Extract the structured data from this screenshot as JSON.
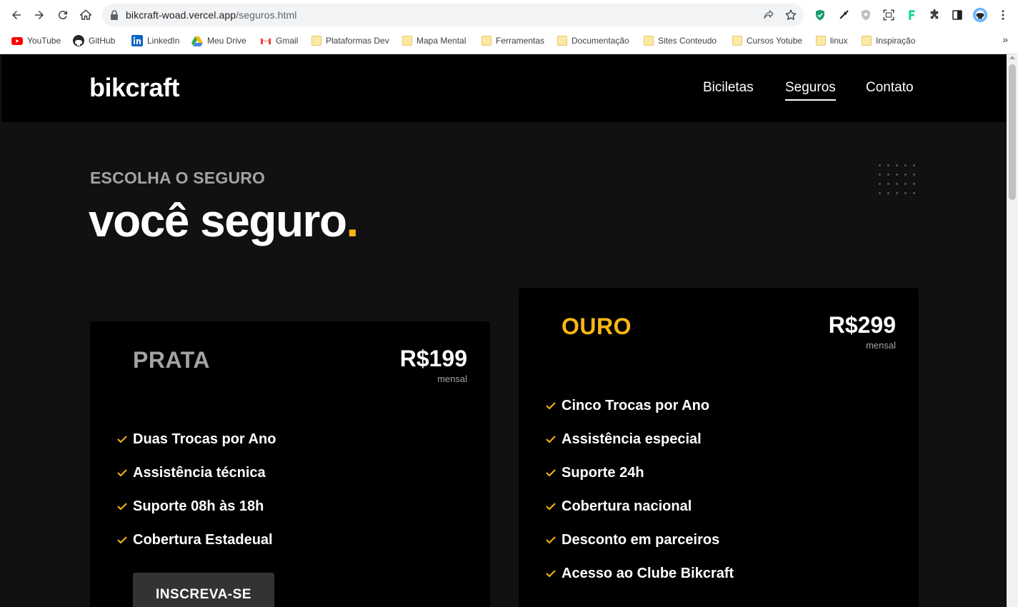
{
  "browser": {
    "url_host": "bikcraft-woad.vercel.app",
    "url_path": "/seguros.html",
    "bookmarks": [
      {
        "label": "YouTube",
        "icon": "youtube-icon"
      },
      {
        "label": "GitHub",
        "icon": "github-icon"
      },
      {
        "label": "LinkedIn",
        "icon": "linkedin-icon"
      },
      {
        "label": "Meu Drive",
        "icon": "drive-icon"
      },
      {
        "label": "Gmail",
        "icon": "gmail-icon"
      },
      {
        "label": "Plataformas Dev",
        "icon": "folder-icon"
      },
      {
        "label": "Mapa Mental",
        "icon": "folder-icon"
      },
      {
        "label": "Ferramentas",
        "icon": "folder-icon"
      },
      {
        "label": "Documentação",
        "icon": "folder-icon"
      },
      {
        "label": "Sites Conteudo",
        "icon": "folder-icon"
      },
      {
        "label": "Cursos Yotube",
        "icon": "folder-icon"
      },
      {
        "label": "linux",
        "icon": "folder-icon"
      },
      {
        "label": "Inspiração",
        "icon": "folder-icon"
      }
    ],
    "more": "»"
  },
  "site": {
    "logo": "bikcraft",
    "nav": [
      "Biciletas",
      "Seguros",
      "Contato"
    ],
    "subtitle": "ESCOLHA O SEGURO",
    "title": "você seguro",
    "title_dot": ".",
    "accent_color": "#fbb614"
  },
  "plans": {
    "prata": {
      "name": "PRATA",
      "price": "R$199",
      "period": "mensal",
      "features": [
        "Duas Trocas por Ano",
        "Assistência técnica",
        "Suporte 08h às 18h",
        "Cobertura Estadeual"
      ],
      "button": "INSCREVA-SE"
    },
    "ouro": {
      "name": "OURO",
      "price": "R$299",
      "period": "mensal",
      "features": [
        "Cinco Trocas por Ano",
        "Assistência especial",
        "Suporte 24h",
        "Cobertura nacional",
        "Desconto em parceiros",
        "Acesso ao Clube Bikcraft"
      ]
    }
  }
}
